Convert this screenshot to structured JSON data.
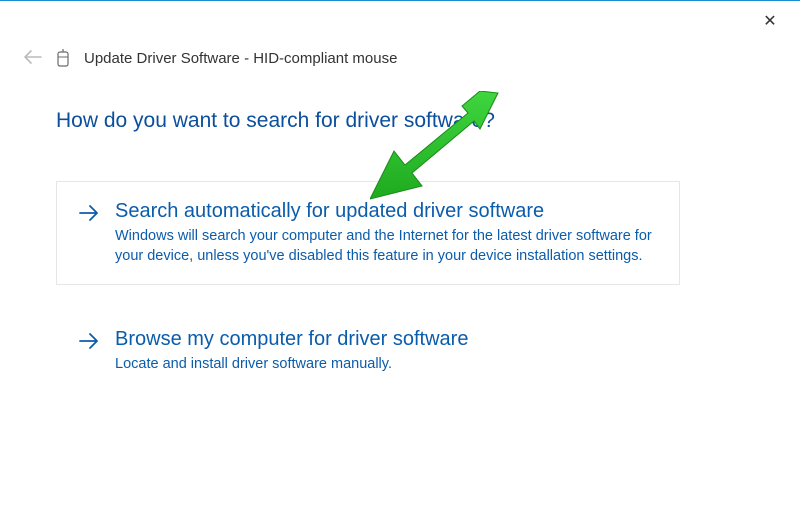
{
  "titlebar": {
    "close_label": "✕"
  },
  "breadcrumb": {
    "text": "Update Driver Software - HID-compliant mouse"
  },
  "heading": "How do you want to search for driver software?",
  "options": {
    "auto": {
      "title": "Search automatically for updated driver software",
      "desc": "Windows will search your computer and the Internet for the latest driver software for your device, unless you've disabled this feature in your device installation settings."
    },
    "browse": {
      "title": "Browse my computer for driver software",
      "desc": "Locate and install driver software manually."
    }
  }
}
